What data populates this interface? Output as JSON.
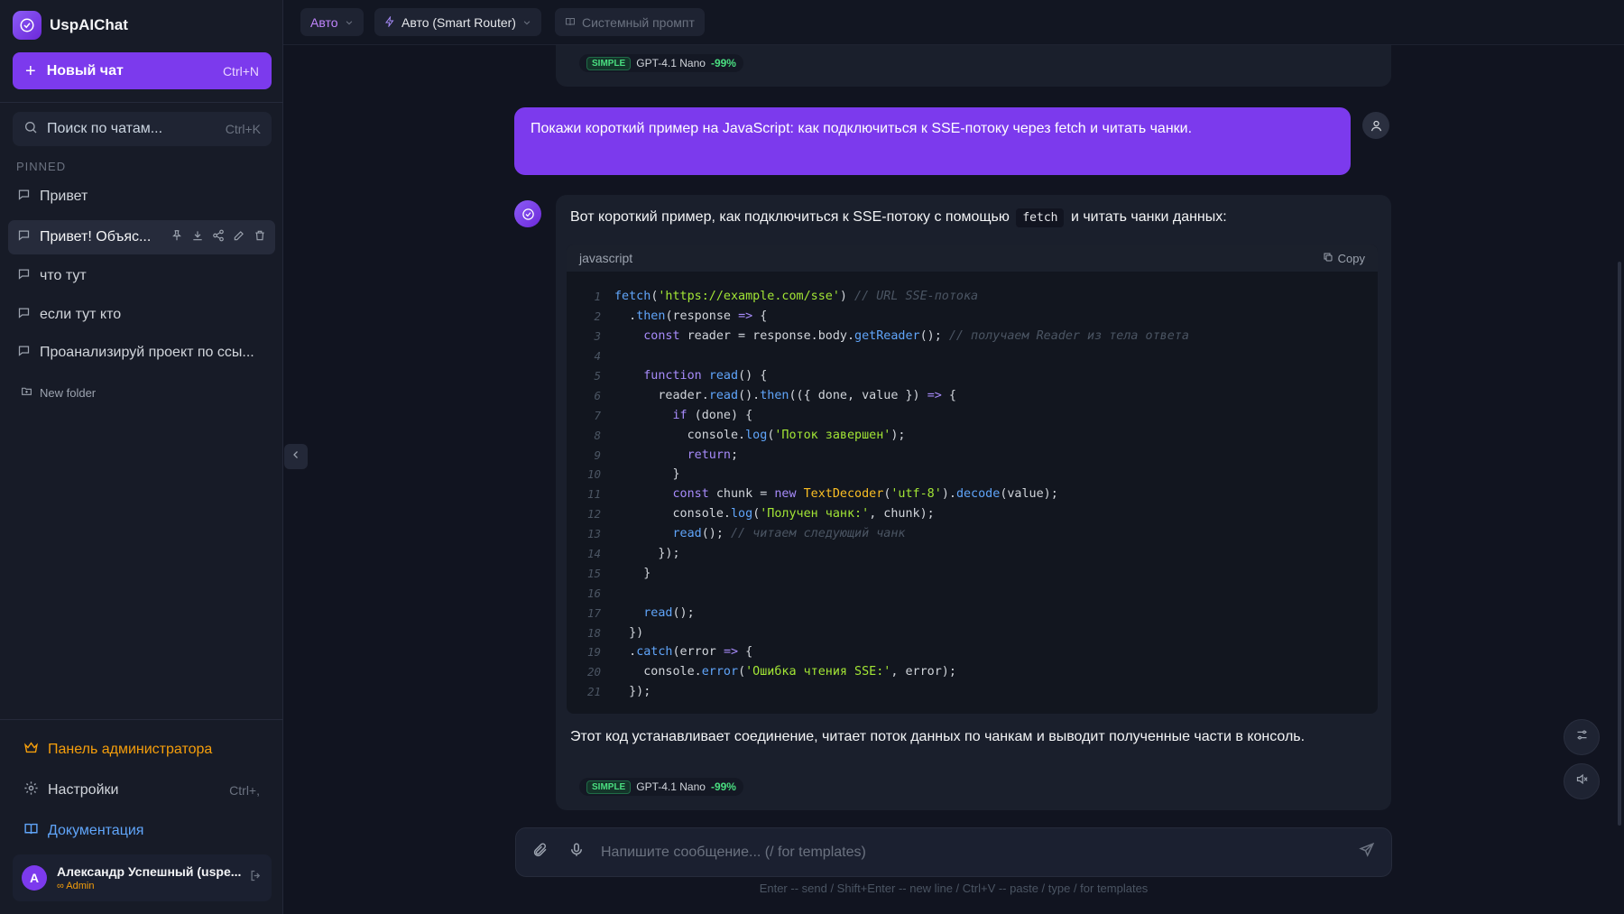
{
  "app": {
    "name": "UspAIChat"
  },
  "sidebar": {
    "new_chat_label": "Новый чат",
    "new_chat_shortcut": "Ctrl+N",
    "search_label": "Поиск по чатам...",
    "search_shortcut": "Ctrl+K",
    "pinned_label": "PINNED",
    "items": [
      {
        "title": "Привет"
      },
      {
        "title": "Привет! Объяс...",
        "active": true
      },
      {
        "title": "что тут"
      },
      {
        "title": "если тут кто"
      },
      {
        "title": "Проанализируй проект по ссы..."
      }
    ],
    "new_folder_label": "New folder",
    "admin_label": "Панель администратора",
    "settings_label": "Настройки",
    "settings_shortcut": "Ctrl+,",
    "docs_label": "Документация",
    "user": {
      "initial": "A",
      "name": "Александр Успешный (uspe...",
      "role": "∞ Admin"
    }
  },
  "topbar": {
    "mode_label": "Авто",
    "router_label": "Авто (Smart Router)",
    "system_prompt_label": "Системный промпт"
  },
  "messages": {
    "prev_badge": {
      "tier": "SIMPLE",
      "model": "GPT-4.1 Nano",
      "savings": "-99%"
    },
    "user_text": "Покажи короткий пример на JavaScript: как подключиться к SSE-потоку через fetch и читать чанки.",
    "assistant": {
      "intro_before": "Вот короткий пример, как подключиться к SSE-потоку с помощью",
      "intro_code": "fetch",
      "intro_after": "и читать чанки данных:",
      "code_lang": "javascript",
      "copy_label": "Copy",
      "outro": "Этот код устанавливает соединение, читает поток данных по чанкам и выводит полученные части в консоль.",
      "badge": {
        "tier": "SIMPLE",
        "model": "GPT-4.1 Nano",
        "savings": "-99%"
      }
    }
  },
  "code_lines": [
    [
      [
        "fn",
        "fetch"
      ],
      [
        "plain",
        "("
      ],
      [
        "str",
        "'https://example.com/sse'"
      ],
      [
        "plain",
        ") "
      ],
      [
        "cmt",
        "// URL SSE-потока"
      ]
    ],
    [
      [
        "plain",
        "  ."
      ],
      [
        "fn",
        "then"
      ],
      [
        "plain",
        "(response "
      ],
      [
        "op",
        "=>"
      ],
      [
        "plain",
        " {"
      ]
    ],
    [
      [
        "plain",
        "    "
      ],
      [
        "kw",
        "const"
      ],
      [
        "plain",
        " reader = response.body."
      ],
      [
        "fn",
        "getReader"
      ],
      [
        "plain",
        "(); "
      ],
      [
        "cmt",
        "// получаем Reader из тела ответа"
      ]
    ],
    [
      [
        "plain",
        ""
      ]
    ],
    [
      [
        "plain",
        "    "
      ],
      [
        "kw",
        "function"
      ],
      [
        "plain",
        " "
      ],
      [
        "fn",
        "read"
      ],
      [
        "plain",
        "() {"
      ]
    ],
    [
      [
        "plain",
        "      reader."
      ],
      [
        "fn",
        "read"
      ],
      [
        "plain",
        "()."
      ],
      [
        "fn",
        "then"
      ],
      [
        "plain",
        "(({ done, value }) "
      ],
      [
        "op",
        "=>"
      ],
      [
        "plain",
        " {"
      ]
    ],
    [
      [
        "plain",
        "        "
      ],
      [
        "kw",
        "if"
      ],
      [
        "plain",
        " (done) {"
      ]
    ],
    [
      [
        "plain",
        "          console."
      ],
      [
        "fn",
        "log"
      ],
      [
        "plain",
        "("
      ],
      [
        "str",
        "'Поток завершен'"
      ],
      [
        "plain",
        ");"
      ]
    ],
    [
      [
        "plain",
        "          "
      ],
      [
        "kw",
        "return"
      ],
      [
        "plain",
        ";"
      ]
    ],
    [
      [
        "plain",
        "        }"
      ]
    ],
    [
      [
        "plain",
        "        "
      ],
      [
        "kw",
        "const"
      ],
      [
        "plain",
        " chunk = "
      ],
      [
        "kw",
        "new"
      ],
      [
        "plain",
        " "
      ],
      [
        "cls",
        "TextDecoder"
      ],
      [
        "plain",
        "("
      ],
      [
        "str",
        "'utf-8'"
      ],
      [
        "plain",
        ")."
      ],
      [
        "fn",
        "decode"
      ],
      [
        "plain",
        "(value);"
      ]
    ],
    [
      [
        "plain",
        "        console."
      ],
      [
        "fn",
        "log"
      ],
      [
        "plain",
        "("
      ],
      [
        "str",
        "'Получен чанк:'"
      ],
      [
        "plain",
        ", chunk);"
      ]
    ],
    [
      [
        "plain",
        "        "
      ],
      [
        "fn",
        "read"
      ],
      [
        "plain",
        "(); "
      ],
      [
        "cmt",
        "// читаем следующий чанк"
      ]
    ],
    [
      [
        "plain",
        "      });"
      ]
    ],
    [
      [
        "plain",
        "    }"
      ]
    ],
    [
      [
        "plain",
        ""
      ]
    ],
    [
      [
        "plain",
        "    "
      ],
      [
        "fn",
        "read"
      ],
      [
        "plain",
        "();"
      ]
    ],
    [
      [
        "plain",
        "  })"
      ]
    ],
    [
      [
        "plain",
        "  ."
      ],
      [
        "fn",
        "catch"
      ],
      [
        "plain",
        "(error "
      ],
      [
        "op",
        "=>"
      ],
      [
        "plain",
        " {"
      ]
    ],
    [
      [
        "plain",
        "    console."
      ],
      [
        "fn",
        "error"
      ],
      [
        "plain",
        "("
      ],
      [
        "str",
        "'Ошибка чтения SSE:'"
      ],
      [
        "plain",
        ", error);"
      ]
    ],
    [
      [
        "plain",
        "  });"
      ]
    ]
  ],
  "composer": {
    "placeholder": "Напишите сообщение... (/ for templates)",
    "hint": "Enter -- send / Shift+Enter -- new line / Ctrl+V -- paste / type / for templates"
  },
  "colors": {
    "accent": "#7c3aed",
    "admin": "#f59e0b",
    "docs": "#60a5fa",
    "success": "#4ade80"
  },
  "icons": [
    "logo-icon",
    "plus-icon",
    "search-icon",
    "chat-icon",
    "pin-icon",
    "download-icon",
    "share-icon",
    "edit-icon",
    "trash-icon",
    "folder-plus-icon",
    "crown-icon",
    "gear-icon",
    "book-icon",
    "logout-icon",
    "chevron-left-icon",
    "chevron-down-icon",
    "bolt-icon",
    "copy-icon",
    "user-icon",
    "paperclip-icon",
    "mic-icon",
    "send-icon",
    "sliders-icon",
    "mute-icon"
  ]
}
